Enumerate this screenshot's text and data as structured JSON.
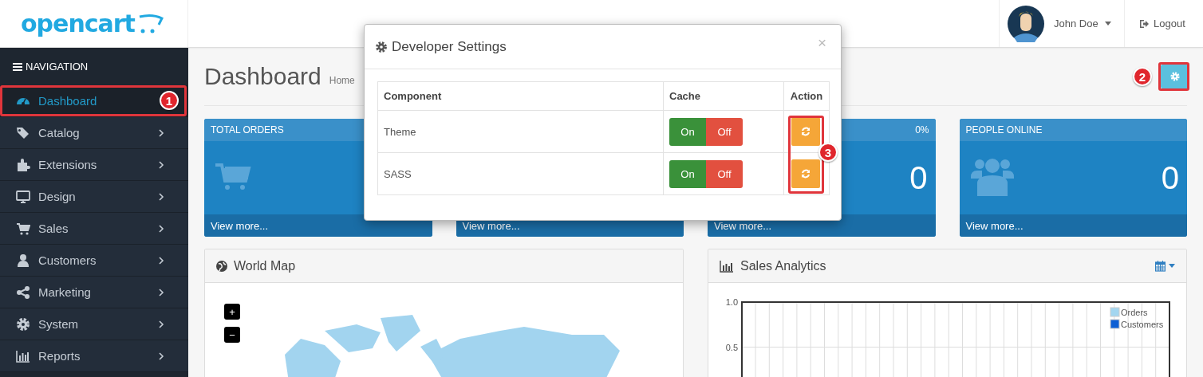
{
  "header": {
    "logo": "opencart",
    "user_name": "John Doe",
    "logout": "Logout"
  },
  "sidebar": {
    "title": "NAVIGATION",
    "items": [
      {
        "label": "Dashboard",
        "selected": true
      },
      {
        "label": "Catalog",
        "selected": false
      },
      {
        "label": "Extensions",
        "selected": false
      },
      {
        "label": "Design",
        "selected": false
      },
      {
        "label": "Sales",
        "selected": false
      },
      {
        "label": "Customers",
        "selected": false
      },
      {
        "label": "Marketing",
        "selected": false
      },
      {
        "label": "System",
        "selected": false
      },
      {
        "label": "Reports",
        "selected": false
      }
    ]
  },
  "page": {
    "title": "Dashboard",
    "breadcrumb": "Home"
  },
  "tiles": [
    {
      "title": "TOTAL ORDERS",
      "footer": "View more..."
    },
    {
      "footer": "View more..."
    },
    {
      "percent": "0%",
      "value": "0",
      "footer": "View more..."
    },
    {
      "title": "PEOPLE ONLINE",
      "value": "0",
      "footer": "View more..."
    }
  ],
  "panels": [
    {
      "title": "World Map",
      "zoom_in": "+",
      "zoom_out": "−"
    },
    {
      "title": "Sales Analytics",
      "chart_data": {
        "type": "line",
        "ylim": [
          0,
          1
        ],
        "yticks": [
          {
            "value": 0.5,
            "label": "0.5"
          },
          {
            "value": 1,
            "label": "1.0"
          }
        ],
        "series": [
          {
            "name": "Orders",
            "color": "#a3d6f0"
          },
          {
            "name": "Customers",
            "color": "#0d5fd4"
          }
        ]
      }
    }
  ],
  "modal": {
    "title": "Developer Settings",
    "close": "×",
    "columns": [
      "Component",
      "Cache",
      "Action"
    ],
    "rows": [
      {
        "component": "Theme",
        "on": "On",
        "off": "Off"
      },
      {
        "component": "SASS",
        "on": "On",
        "off": "Off"
      }
    ]
  },
  "annotations": [
    {
      "number": "1"
    },
    {
      "number": "2"
    },
    {
      "number": "3"
    }
  ]
}
